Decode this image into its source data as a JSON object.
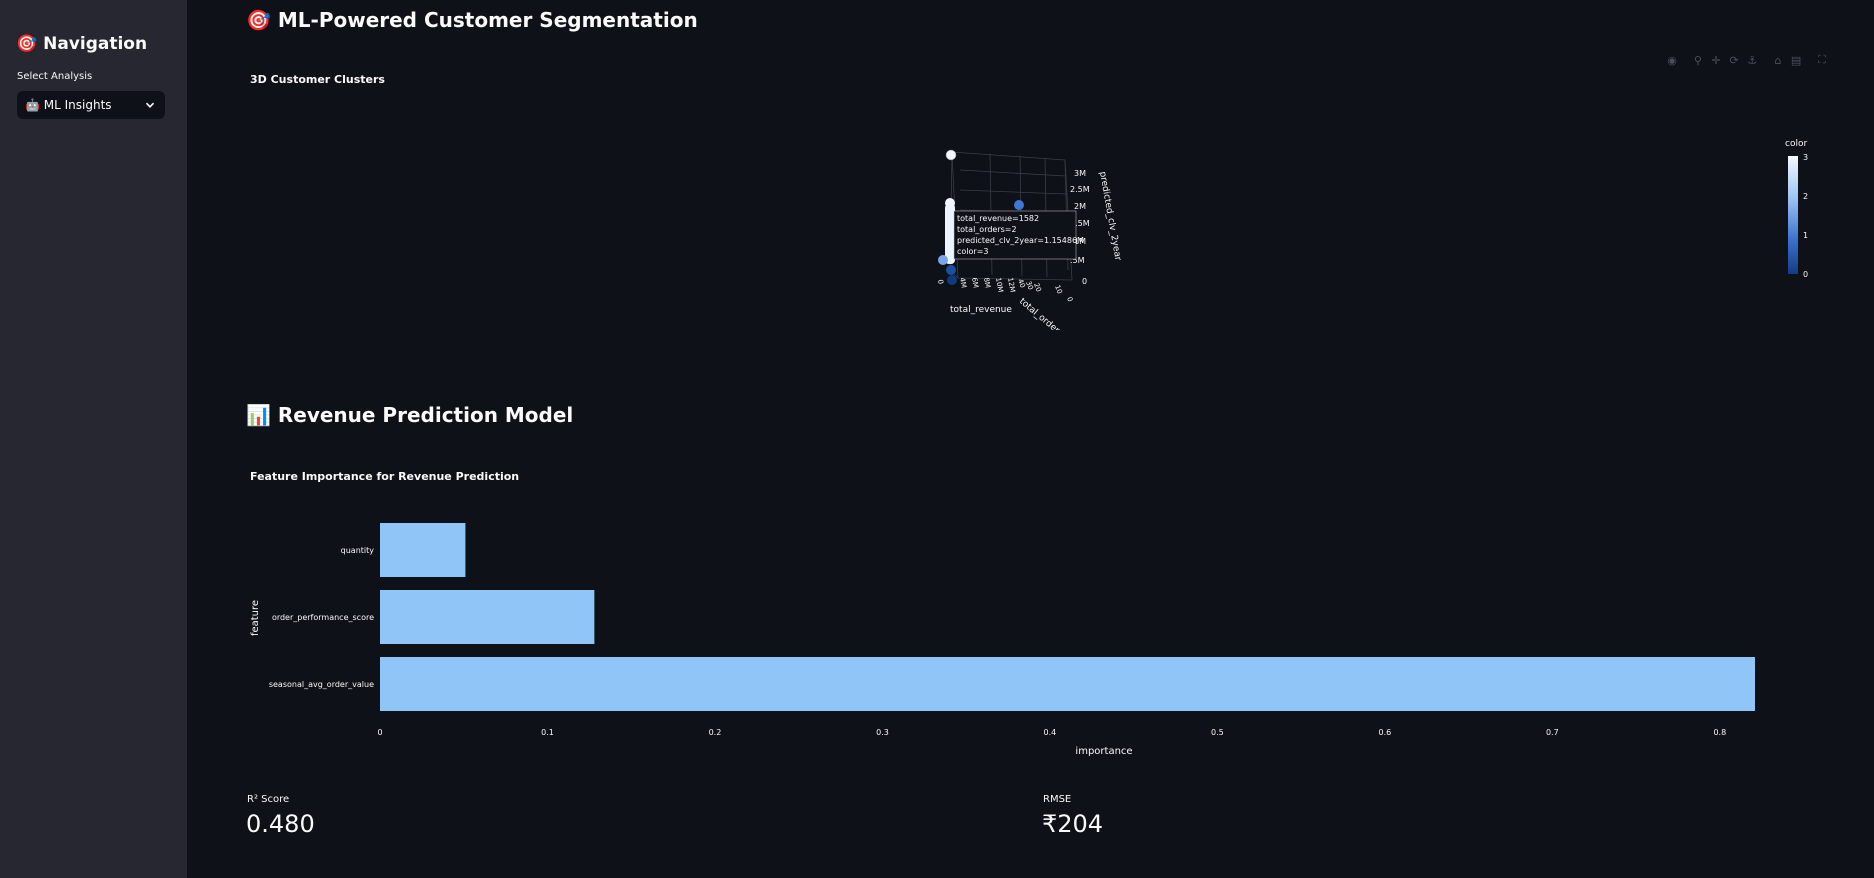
{
  "sidebar": {
    "title": "🎯 Navigation",
    "select_label": "Select Analysis",
    "select_value": "🤖 ML Insights"
  },
  "main": {
    "title": "🎯 ML-Powered Customer Segmentation",
    "section_title": "📊 Revenue Prediction Model"
  },
  "modebar": {
    "icons": [
      "camera-icon",
      "zoom-icon",
      "pan-icon",
      "orbit-icon",
      "turntable-icon",
      "home-icon",
      "reset-camera-icon",
      "fullscreen-icon"
    ]
  },
  "scatter3d": {
    "title": "3D Customer Clusters",
    "x_title": "total_revenue",
    "y_title": "total_orders",
    "z_title": "predicted_clv_2year",
    "x_ticks": [
      "0",
      "4M",
      "6M",
      "8M",
      "10M",
      "12M"
    ],
    "y_ticks": [
      "0",
      "10",
      "20",
      "30",
      "40"
    ],
    "z_ticks": [
      "0",
      ".5M",
      "1M",
      "1.5M",
      "2M",
      "2.5M",
      "3M"
    ],
    "colorbar_title": "color",
    "colorbar_ticks": [
      "3",
      "2",
      "1",
      "0"
    ],
    "tooltip": [
      "total_revenue=1582",
      "total_orders=2",
      "predicted_clv_2year=1.15486M",
      "color=3"
    ]
  },
  "chart_data": {
    "type": "bar",
    "orientation": "horizontal",
    "title": "Feature Importance for Revenue Prediction",
    "xlabel": "importance",
    "ylabel": "feature",
    "categories": [
      "quantity",
      "order_performance_score",
      "seasonal_avg_order_value"
    ],
    "values": [
      0.051,
      0.128,
      0.821
    ],
    "xlim": [
      0,
      0.821
    ],
    "x_ticks": [
      0,
      0.1,
      0.2,
      0.3,
      0.4,
      0.5,
      0.6,
      0.7,
      0.8
    ],
    "bar_color": "#90c5f7",
    "grid": false
  },
  "metrics": {
    "r2_label": "R² Score",
    "r2_value": "0.480",
    "rmse_label": "RMSE",
    "rmse_value": "₹204"
  }
}
